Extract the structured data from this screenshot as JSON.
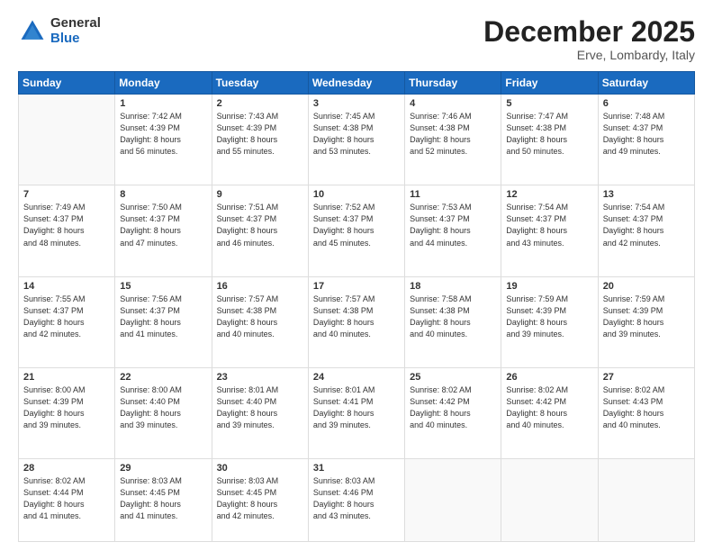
{
  "logo": {
    "general": "General",
    "blue": "Blue"
  },
  "title": "December 2025",
  "location": "Erve, Lombardy, Italy",
  "days_header": [
    "Sunday",
    "Monday",
    "Tuesday",
    "Wednesday",
    "Thursday",
    "Friday",
    "Saturday"
  ],
  "weeks": [
    [
      {
        "day": "",
        "info": ""
      },
      {
        "day": "1",
        "info": "Sunrise: 7:42 AM\nSunset: 4:39 PM\nDaylight: 8 hours\nand 56 minutes."
      },
      {
        "day": "2",
        "info": "Sunrise: 7:43 AM\nSunset: 4:39 PM\nDaylight: 8 hours\nand 55 minutes."
      },
      {
        "day": "3",
        "info": "Sunrise: 7:45 AM\nSunset: 4:38 PM\nDaylight: 8 hours\nand 53 minutes."
      },
      {
        "day": "4",
        "info": "Sunrise: 7:46 AM\nSunset: 4:38 PM\nDaylight: 8 hours\nand 52 minutes."
      },
      {
        "day": "5",
        "info": "Sunrise: 7:47 AM\nSunset: 4:38 PM\nDaylight: 8 hours\nand 50 minutes."
      },
      {
        "day": "6",
        "info": "Sunrise: 7:48 AM\nSunset: 4:37 PM\nDaylight: 8 hours\nand 49 minutes."
      }
    ],
    [
      {
        "day": "7",
        "info": "Sunrise: 7:49 AM\nSunset: 4:37 PM\nDaylight: 8 hours\nand 48 minutes."
      },
      {
        "day": "8",
        "info": "Sunrise: 7:50 AM\nSunset: 4:37 PM\nDaylight: 8 hours\nand 47 minutes."
      },
      {
        "day": "9",
        "info": "Sunrise: 7:51 AM\nSunset: 4:37 PM\nDaylight: 8 hours\nand 46 minutes."
      },
      {
        "day": "10",
        "info": "Sunrise: 7:52 AM\nSunset: 4:37 PM\nDaylight: 8 hours\nand 45 minutes."
      },
      {
        "day": "11",
        "info": "Sunrise: 7:53 AM\nSunset: 4:37 PM\nDaylight: 8 hours\nand 44 minutes."
      },
      {
        "day": "12",
        "info": "Sunrise: 7:54 AM\nSunset: 4:37 PM\nDaylight: 8 hours\nand 43 minutes."
      },
      {
        "day": "13",
        "info": "Sunrise: 7:54 AM\nSunset: 4:37 PM\nDaylight: 8 hours\nand 42 minutes."
      }
    ],
    [
      {
        "day": "14",
        "info": "Sunrise: 7:55 AM\nSunset: 4:37 PM\nDaylight: 8 hours\nand 42 minutes."
      },
      {
        "day": "15",
        "info": "Sunrise: 7:56 AM\nSunset: 4:37 PM\nDaylight: 8 hours\nand 41 minutes."
      },
      {
        "day": "16",
        "info": "Sunrise: 7:57 AM\nSunset: 4:38 PM\nDaylight: 8 hours\nand 40 minutes."
      },
      {
        "day": "17",
        "info": "Sunrise: 7:57 AM\nSunset: 4:38 PM\nDaylight: 8 hours\nand 40 minutes."
      },
      {
        "day": "18",
        "info": "Sunrise: 7:58 AM\nSunset: 4:38 PM\nDaylight: 8 hours\nand 40 minutes."
      },
      {
        "day": "19",
        "info": "Sunrise: 7:59 AM\nSunset: 4:39 PM\nDaylight: 8 hours\nand 39 minutes."
      },
      {
        "day": "20",
        "info": "Sunrise: 7:59 AM\nSunset: 4:39 PM\nDaylight: 8 hours\nand 39 minutes."
      }
    ],
    [
      {
        "day": "21",
        "info": "Sunrise: 8:00 AM\nSunset: 4:39 PM\nDaylight: 8 hours\nand 39 minutes."
      },
      {
        "day": "22",
        "info": "Sunrise: 8:00 AM\nSunset: 4:40 PM\nDaylight: 8 hours\nand 39 minutes."
      },
      {
        "day": "23",
        "info": "Sunrise: 8:01 AM\nSunset: 4:40 PM\nDaylight: 8 hours\nand 39 minutes."
      },
      {
        "day": "24",
        "info": "Sunrise: 8:01 AM\nSunset: 4:41 PM\nDaylight: 8 hours\nand 39 minutes."
      },
      {
        "day": "25",
        "info": "Sunrise: 8:02 AM\nSunset: 4:42 PM\nDaylight: 8 hours\nand 40 minutes."
      },
      {
        "day": "26",
        "info": "Sunrise: 8:02 AM\nSunset: 4:42 PM\nDaylight: 8 hours\nand 40 minutes."
      },
      {
        "day": "27",
        "info": "Sunrise: 8:02 AM\nSunset: 4:43 PM\nDaylight: 8 hours\nand 40 minutes."
      }
    ],
    [
      {
        "day": "28",
        "info": "Sunrise: 8:02 AM\nSunset: 4:44 PM\nDaylight: 8 hours\nand 41 minutes."
      },
      {
        "day": "29",
        "info": "Sunrise: 8:03 AM\nSunset: 4:45 PM\nDaylight: 8 hours\nand 41 minutes."
      },
      {
        "day": "30",
        "info": "Sunrise: 8:03 AM\nSunset: 4:45 PM\nDaylight: 8 hours\nand 42 minutes."
      },
      {
        "day": "31",
        "info": "Sunrise: 8:03 AM\nSunset: 4:46 PM\nDaylight: 8 hours\nand 43 minutes."
      },
      {
        "day": "",
        "info": ""
      },
      {
        "day": "",
        "info": ""
      },
      {
        "day": "",
        "info": ""
      }
    ]
  ]
}
